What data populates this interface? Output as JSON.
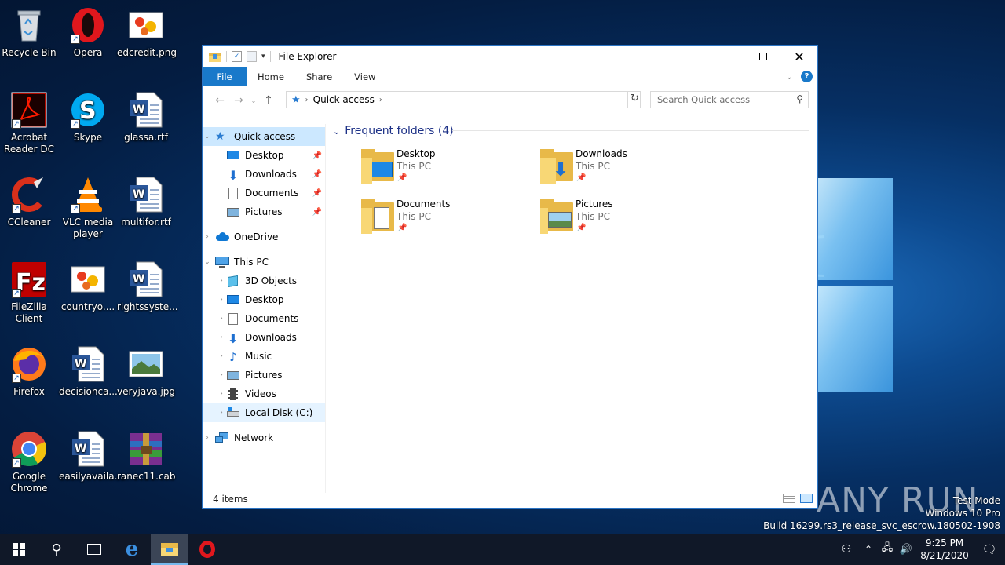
{
  "desktop": {
    "icons": [
      {
        "label": "Recycle Bin",
        "icon": "recycle-bin-icon"
      },
      {
        "label": "Opera",
        "icon": "opera-icon"
      },
      {
        "label": "edcredit.png",
        "icon": "image-file-icon"
      },
      {
        "label": "Acrobat Reader DC",
        "icon": "acrobat-icon"
      },
      {
        "label": "Skype",
        "icon": "skype-icon"
      },
      {
        "label": "glassa.rtf",
        "icon": "word-doc-icon"
      },
      {
        "label": "CCleaner",
        "icon": "ccleaner-icon"
      },
      {
        "label": "VLC media player",
        "icon": "vlc-icon"
      },
      {
        "label": "multifor.rtf",
        "icon": "word-doc-icon"
      },
      {
        "label": "FileZilla Client",
        "icon": "filezilla-icon"
      },
      {
        "label": "countryo....",
        "icon": "image-file-icon"
      },
      {
        "label": "rightssyste...",
        "icon": "word-doc-icon"
      },
      {
        "label": "Firefox",
        "icon": "firefox-icon"
      },
      {
        "label": "decisionca...",
        "icon": "word-doc-icon"
      },
      {
        "label": "veryjava.jpg",
        "icon": "landscape-image-icon"
      },
      {
        "label": "Google Chrome",
        "icon": "chrome-icon"
      },
      {
        "label": "easilyavaila...",
        "icon": "word-doc-icon"
      },
      {
        "label": "ranec11.cab",
        "icon": "winrar-icon"
      }
    ]
  },
  "explorer": {
    "title": "File Explorer",
    "tabs": [
      "File",
      "Home",
      "Share",
      "View"
    ],
    "address": {
      "location": "Quick access"
    },
    "search": {
      "placeholder": "Search Quick access"
    },
    "nav": {
      "quick_access": "Quick access",
      "qa_items": [
        "Desktop",
        "Downloads",
        "Documents",
        "Pictures"
      ],
      "onedrive": "OneDrive",
      "this_pc": "This PC",
      "pc_items": [
        "3D Objects",
        "Desktop",
        "Documents",
        "Downloads",
        "Music",
        "Pictures",
        "Videos",
        "Local Disk (C:)"
      ],
      "network": "Network"
    },
    "group_header": "Frequent folders (4)",
    "folders": [
      {
        "name": "Desktop",
        "location": "This PC"
      },
      {
        "name": "Downloads",
        "location": "This PC"
      },
      {
        "name": "Documents",
        "location": "This PC"
      },
      {
        "name": "Pictures",
        "location": "This PC"
      }
    ],
    "status": "4 items"
  },
  "watermark": {
    "brand": "ANY RUN",
    "line1": "Test Mode",
    "line2": "Windows 10 Pro",
    "line3": "Build 16299.rs3_release_svc_escrow.180502-1908"
  },
  "taskbar": {
    "time": "9:25 PM",
    "date": "8/21/2020"
  },
  "colors": {
    "accent": "#1979ca",
    "selection": "#cce8ff",
    "taskbar": "#101828"
  }
}
